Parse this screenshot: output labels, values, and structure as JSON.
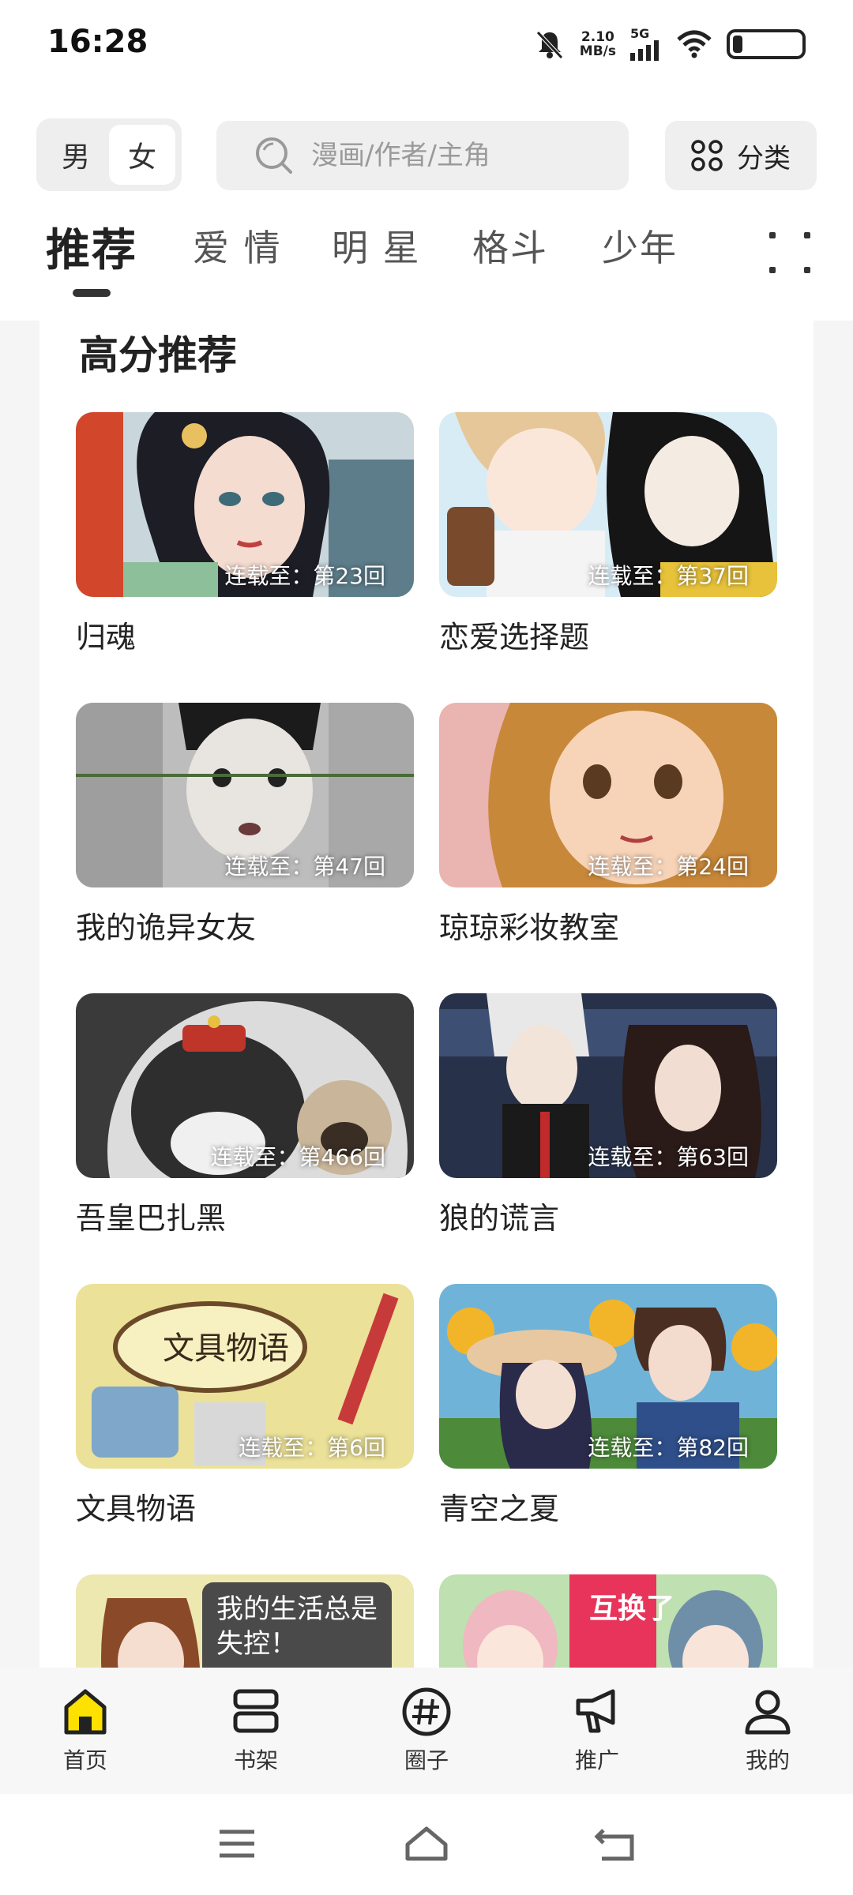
{
  "status_bar": {
    "time": "16:28",
    "net_speed_value": "2.10",
    "net_speed_unit": "MB/s",
    "network": "5G",
    "icons": [
      "bell-muted-icon",
      "signal-icon",
      "wifi-icon",
      "battery-icon"
    ]
  },
  "header": {
    "gender": [
      "男",
      "女"
    ],
    "selected_gender": "女",
    "search_placeholder": "漫画/作者/主角",
    "category_label": "分类"
  },
  "tabs": [
    "推荐",
    "爱 情",
    "明 星",
    "格斗",
    "少年"
  ],
  "section": {
    "title": "高分推荐"
  },
  "comics": [
    {
      "title": "归魂",
      "episode": "连载至：第23回"
    },
    {
      "title": "恋爱选择题",
      "episode": "连载至：第37回"
    },
    {
      "title": "我的诡异女友",
      "episode": "连载至：第47回"
    },
    {
      "title": "琼琼彩妆教室",
      "episode": "连载至：第24回"
    },
    {
      "title": "吾皇巴扎黑",
      "episode": "连载至：第466回"
    },
    {
      "title": "狼的谎言",
      "episode": "连载至：第63回"
    },
    {
      "title": "文具物语",
      "episode": "连载至：第6回"
    },
    {
      "title": "青空之夏",
      "episode": "连载至：第82回"
    }
  ],
  "partial_covers": [
    {
      "text": "我的生活总是失控！"
    },
    {
      "text": "互换了"
    }
  ],
  "bottom_nav": [
    {
      "label": "首页",
      "icon": "home-icon",
      "active": true
    },
    {
      "label": "书架",
      "icon": "bookshelf-icon",
      "active": false
    },
    {
      "label": "圈子",
      "icon": "hashtag-icon",
      "active": false
    },
    {
      "label": "推广",
      "icon": "megaphone-icon",
      "active": false
    },
    {
      "label": "我的",
      "icon": "profile-icon",
      "active": false
    }
  ],
  "colors": {
    "accent": "#ffe100",
    "text": "#222222",
    "search_bg": "#efefef"
  }
}
